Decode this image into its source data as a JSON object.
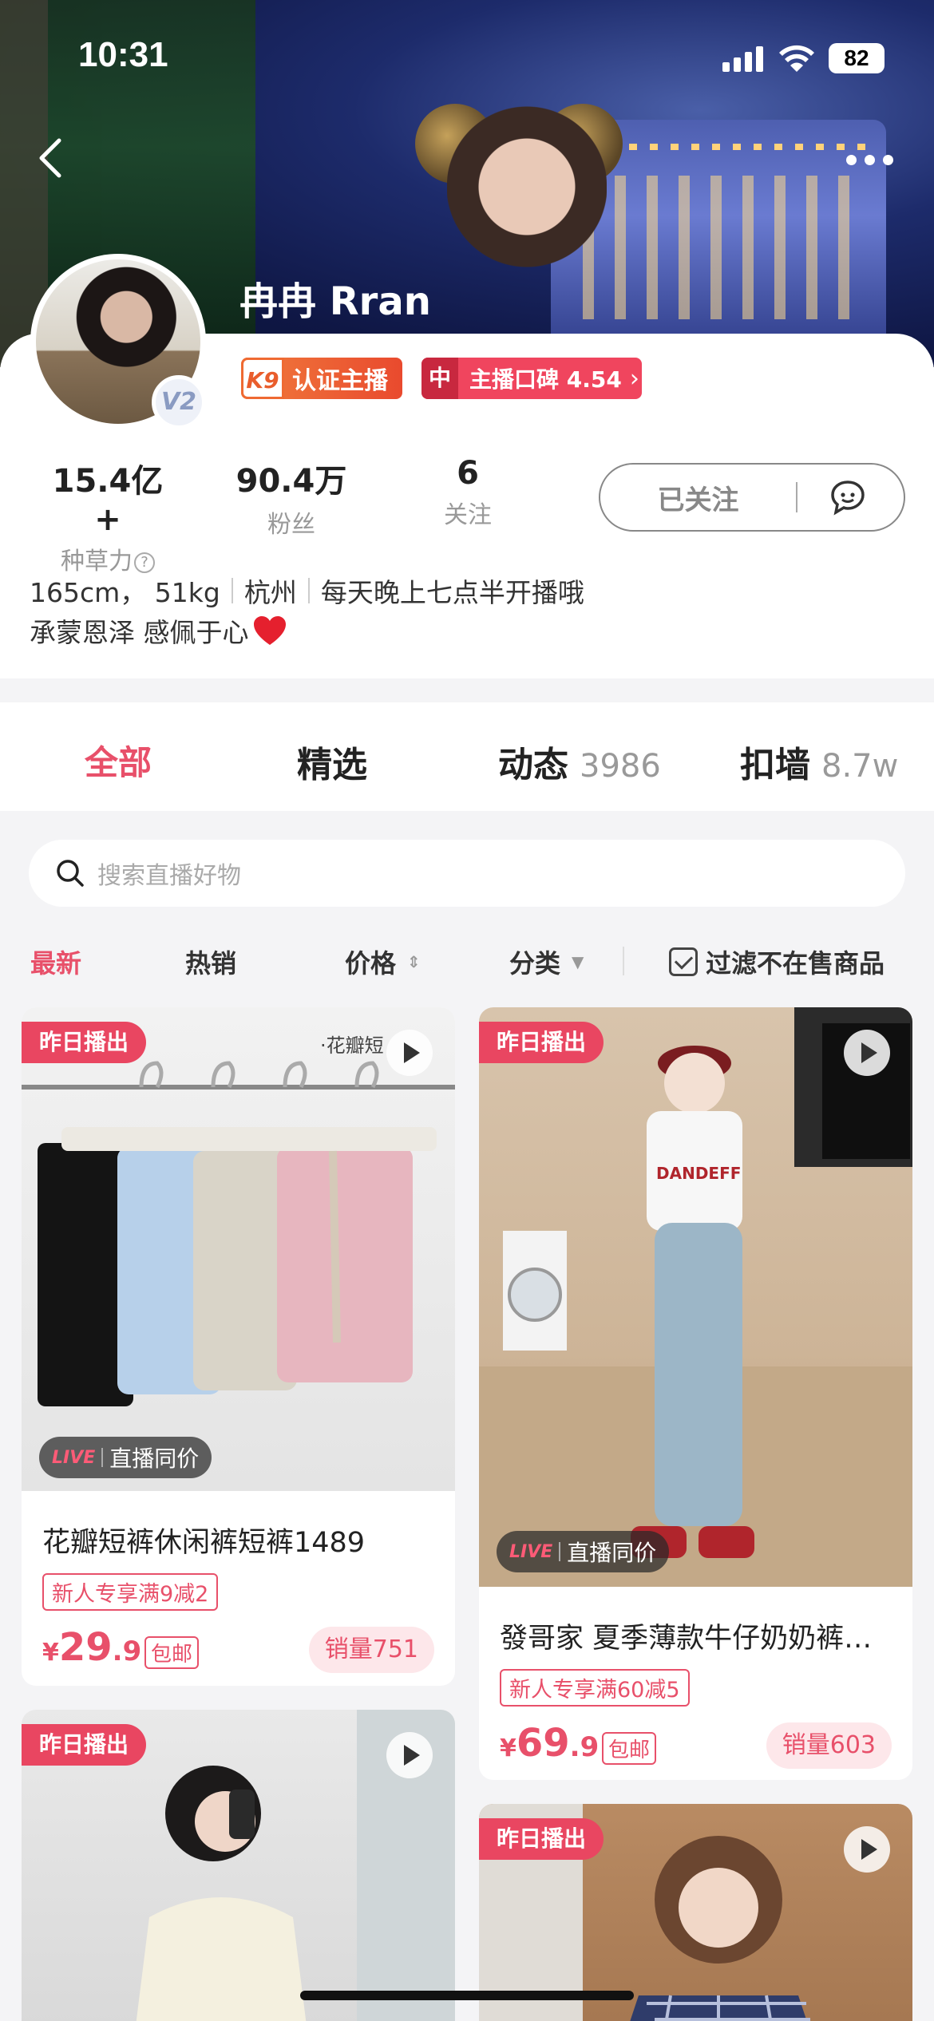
{
  "status_bar": {
    "time": "10:31",
    "battery": "82"
  },
  "profile": {
    "name": "冉冉 Rran",
    "level_badge": "K9",
    "certified_label": "认证主播",
    "reputation_prefix": "中",
    "reputation_label": "主播口碑 4.54",
    "stats": [
      {
        "value": "15.4亿+",
        "label": "种草力"
      },
      {
        "value": "90.4万",
        "label": "粉丝"
      },
      {
        "value": "6",
        "label": "关注"
      }
    ],
    "follow_label": "已关注",
    "bio_line1": [
      "165cm， 51kg",
      "杭州",
      "每天晚上七点半开播哦"
    ],
    "bio_line2": "承蒙恩泽 感佩于心"
  },
  "tabs": [
    {
      "label": "全部"
    },
    {
      "label": "精选"
    },
    {
      "label": "动态",
      "count": "3986"
    },
    {
      "label": "扣墙",
      "count": "8.7w"
    }
  ],
  "search": {
    "placeholder": "搜索直播好物"
  },
  "filters": {
    "items": [
      "最新",
      "热销",
      "价格",
      "分类"
    ],
    "exclude_label": "过滤不在售商品"
  },
  "products": [
    {
      "tag": "昨日播出",
      "live_label": "LIVE",
      "live_text": "直播同价",
      "title": "花瓣短裤休闲裤短裤1489",
      "promo": "新人专享满9减2",
      "price_currency": "¥",
      "price_int": "29",
      "price_dec": ".9",
      "shipping": "包邮",
      "sales": "销量751",
      "watermark": "·花瓣短"
    },
    {
      "tag": "昨日播出",
      "live_label": "LIVE",
      "live_text": "直播同价",
      "title": "發哥家 夏季薄款牛仔奶奶裤…",
      "promo": "新人专享满60减5",
      "price_currency": "¥",
      "price_int": "69",
      "price_dec": ".9",
      "shipping": "包邮",
      "sales": "销量603",
      "shirt_text": "DANDEFF"
    },
    {
      "tag": "昨日播出"
    },
    {
      "tag": "昨日播出"
    }
  ],
  "colors": {
    "accent": "#e8506a",
    "tag_red": "#e94661"
  }
}
